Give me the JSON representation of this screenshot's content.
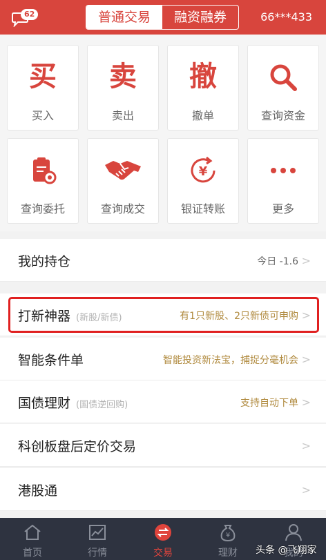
{
  "header": {
    "message_badge": "62",
    "segments": [
      "普通交易",
      "融资融券"
    ],
    "account": "66***433"
  },
  "grid": [
    {
      "glyph": "买",
      "label": "买入"
    },
    {
      "glyph": "卖",
      "label": "卖出"
    },
    {
      "glyph": "撤",
      "label": "撤单"
    },
    {
      "icon": "search-icon",
      "label": "查询资金"
    },
    {
      "icon": "clipboard-icon",
      "label": "查询委托"
    },
    {
      "icon": "handshake-icon",
      "label": "查询成交"
    },
    {
      "icon": "yuan-transfer-icon",
      "label": "银证转账"
    },
    {
      "icon": "more-dots-icon",
      "label": "更多"
    }
  ],
  "holdings": {
    "title": "我的持仓",
    "right": "今日 -1.6"
  },
  "menu": [
    {
      "title": "打新神器",
      "sub": "(新股/新债)",
      "right": "有1只新股、2只新债可申购"
    },
    {
      "title": "智能条件单",
      "sub": "",
      "right": "智能投资新法宝，捕捉分毫机会"
    },
    {
      "title": "国债理财",
      "sub": "(国债逆回购)",
      "right": "支持自动下单"
    },
    {
      "title": "科创板盘后定价交易",
      "sub": "",
      "right": ""
    },
    {
      "title": "港股通",
      "sub": "",
      "right": ""
    }
  ],
  "tabs": [
    {
      "label": "首页",
      "icon": "home-icon"
    },
    {
      "label": "行情",
      "icon": "chart-icon"
    },
    {
      "label": "交易",
      "icon": "trade-icon"
    },
    {
      "label": "理财",
      "icon": "money-bag-icon"
    },
    {
      "label": "我的",
      "icon": "person-icon"
    }
  ],
  "watermark": "头条 @飞翔家",
  "colors": {
    "brand": "#d8453d",
    "gold": "#b08a3e",
    "tabbar": "#2e3340"
  }
}
